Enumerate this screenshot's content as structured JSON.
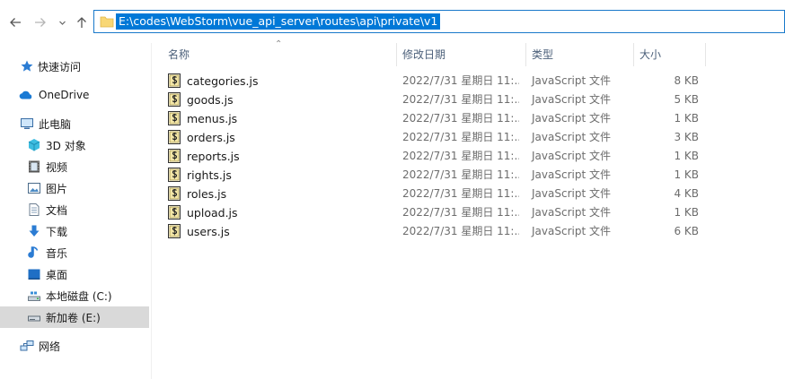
{
  "address_bar": {
    "path": "E:\\codes\\WebStorm\\vue_api_server\\routes\\api\\private\\v1"
  },
  "sidebar": {
    "items": [
      {
        "label": "快速访问",
        "icon": "star-icon"
      },
      {
        "label": "OneDrive",
        "icon": "cloud-icon"
      },
      {
        "label": "此电脑",
        "icon": "computer-icon"
      },
      {
        "label": "3D 对象",
        "icon": "cube-icon"
      },
      {
        "label": "视频",
        "icon": "video-icon"
      },
      {
        "label": "图片",
        "icon": "picture-icon"
      },
      {
        "label": "文档",
        "icon": "document-icon"
      },
      {
        "label": "下载",
        "icon": "download-icon"
      },
      {
        "label": "音乐",
        "icon": "music-icon"
      },
      {
        "label": "桌面",
        "icon": "desktop-icon"
      },
      {
        "label": "本地磁盘 (C:)",
        "icon": "drive-c-icon"
      },
      {
        "label": "新加卷 (E:)",
        "icon": "drive-icon",
        "selected": true
      },
      {
        "label": "网络",
        "icon": "network-icon"
      }
    ]
  },
  "columns": {
    "name": "名称",
    "date": "修改日期",
    "type": "类型",
    "size": "大小"
  },
  "files": [
    {
      "name": "categories.js",
      "date": "2022/7/31 星期日 11:...",
      "type": "JavaScript 文件",
      "size": "8 KB"
    },
    {
      "name": "goods.js",
      "date": "2022/7/31 星期日 11:...",
      "type": "JavaScript 文件",
      "size": "5 KB"
    },
    {
      "name": "menus.js",
      "date": "2022/7/31 星期日 11:...",
      "type": "JavaScript 文件",
      "size": "1 KB"
    },
    {
      "name": "orders.js",
      "date": "2022/7/31 星期日 11:...",
      "type": "JavaScript 文件",
      "size": "3 KB"
    },
    {
      "name": "reports.js",
      "date": "2022/7/31 星期日 11:...",
      "type": "JavaScript 文件",
      "size": "1 KB"
    },
    {
      "name": "rights.js",
      "date": "2022/7/31 星期日 11:...",
      "type": "JavaScript 文件",
      "size": "1 KB"
    },
    {
      "name": "roles.js",
      "date": "2022/7/31 星期日 11:...",
      "type": "JavaScript 文件",
      "size": "4 KB"
    },
    {
      "name": "upload.js",
      "date": "2022/7/31 星期日 11:...",
      "type": "JavaScript 文件",
      "size": "1 KB"
    },
    {
      "name": "users.js",
      "date": "2022/7/31 星期日 11:...",
      "type": "JavaScript 文件",
      "size": "6 KB"
    }
  ],
  "colors": {
    "accent": "#0078d7",
    "selection": "#cce8ff",
    "header_text": "#4c607a"
  }
}
